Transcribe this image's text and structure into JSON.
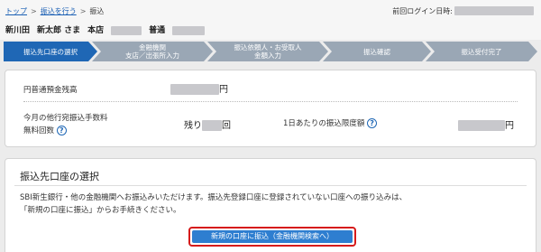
{
  "breadcrumb": {
    "items": [
      "トップ",
      "振込を行う",
      "振込"
    ],
    "separator": ">"
  },
  "header": {
    "last_login_label": "前回ログイン日時:",
    "branch": "新川田",
    "user_name": "新太郎 さま",
    "store_label": "本店",
    "account_type": "普通"
  },
  "steps": [
    {
      "label": "振込先口座の選択",
      "active": true
    },
    {
      "label": "金融機関\n支店／出張所入力",
      "active": false
    },
    {
      "label": "振込依頼人・お受取人\n金額入力",
      "active": false
    },
    {
      "label": "振込確認",
      "active": false
    },
    {
      "label": "振込受付完了",
      "active": false
    }
  ],
  "balance": {
    "label": "円普通預金残高",
    "unit": "円"
  },
  "fee": {
    "label_line1": "今月の他行宛振込手数料",
    "label_line2": "無料回数",
    "remaining_prefix": "残り",
    "remaining_suffix": "回"
  },
  "limit": {
    "label": "1日あたりの振込限度額",
    "unit": "円"
  },
  "help_icon_text": "?",
  "selection": {
    "title": "振込先口座の選択",
    "desc_line1": "SBI新生銀行・他の金融機関へお振込みいただけます。振込先登録口座に登録されていない口座への振り込みは、",
    "desc_line2": "「新規の口座に振込」からお手続きください。",
    "button_label": "新規の口座に振込（金融機関検索へ）"
  },
  "colors": {
    "step_active": "#1f67b5",
    "step_inactive": "#9aa7b5",
    "button": "#2e7ed0",
    "highlight_border": "#d61b1b"
  }
}
